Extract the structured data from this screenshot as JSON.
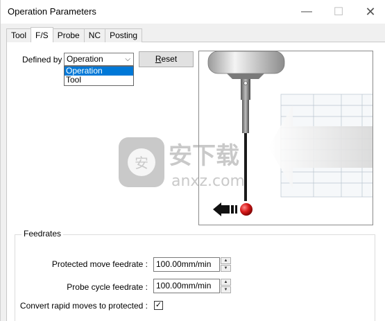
{
  "window": {
    "title": "Operation Parameters",
    "minimize_glyph": "—",
    "maximize_glyph": "☐",
    "close_glyph": "✕"
  },
  "tabs": [
    {
      "label": "Tool",
      "active": false
    },
    {
      "label": "F/S",
      "active": true
    },
    {
      "label": "Probe",
      "active": false
    },
    {
      "label": "NC",
      "active": false
    },
    {
      "label": "Posting",
      "active": false
    }
  ],
  "defined_by": {
    "label": "Defined by :",
    "value": "Operation",
    "options": [
      "Operation",
      "Tool"
    ],
    "highlighted": "Operation"
  },
  "reset_button": {
    "prefix": "",
    "accel": "R",
    "rest": "eset"
  },
  "feedrates": {
    "group_label": "Feedrates",
    "protected_move": {
      "label": "Protected move feedrate :",
      "value": "100.00mm/min"
    },
    "probe_cycle": {
      "label": "Probe cycle feedrate :",
      "value": "100.00mm/min"
    },
    "convert_rapid": {
      "label": "Convert rapid moves to protected :",
      "checked": true
    }
  },
  "watermark": {
    "text": "安下载",
    "sub": "anxz.com"
  },
  "colors": {
    "accent": "#0078d7",
    "probe_ball": "#d81b1b"
  }
}
